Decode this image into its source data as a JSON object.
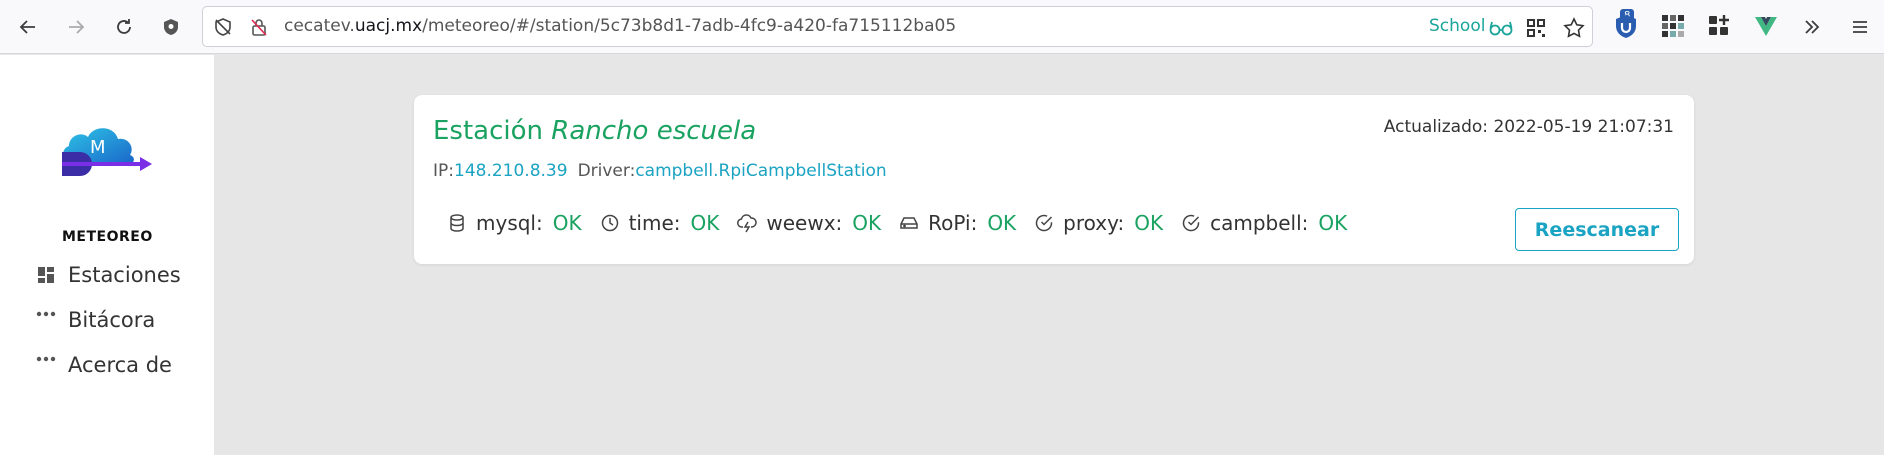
{
  "browser": {
    "url_prefix": "cecatev.",
    "url_domain": "uacj.mx",
    "url_path": "/meteoreo/#/station/5c73b8d1-7adb-4fc9-a420-fa715112ba05",
    "profile_label": "School",
    "extension_badge": "8",
    "accent_color": "#1ba59b"
  },
  "sidebar": {
    "logo_text": "METEOREO",
    "logo_mark": "M",
    "items": [
      {
        "label": "Estaciones",
        "icon": "dashboard-icon"
      },
      {
        "label": "Bitácora",
        "icon": "dots-icon"
      },
      {
        "label": "Acerca de",
        "icon": "dots-icon"
      }
    ]
  },
  "station": {
    "title_prefix": "Estación",
    "name": "Rancho escuela",
    "updated_label": "Actualizado:",
    "updated_value": "2022-05-19 21:07:31",
    "ip_label": "IP:",
    "ip_value": "148.210.8.39",
    "driver_label": "Driver:",
    "driver_value": "campbell.RpiCampbellStation",
    "statuses": [
      {
        "label": "mysql:",
        "value": "OK",
        "icon": "database-icon"
      },
      {
        "label": "time:",
        "value": "OK",
        "icon": "clock-icon"
      },
      {
        "label": "weewx:",
        "value": "OK",
        "icon": "cloud-lightning-icon"
      },
      {
        "label": "RoPi:",
        "value": "OK",
        "icon": "hard-drive-icon"
      },
      {
        "label": "proxy:",
        "value": "OK",
        "icon": "check-circle-icon"
      },
      {
        "label": "campbell:",
        "value": "OK",
        "icon": "check-circle-icon"
      }
    ],
    "rescan_label": "Reescanear",
    "ok_color": "#1aa260",
    "link_color": "#1aa3c2"
  }
}
